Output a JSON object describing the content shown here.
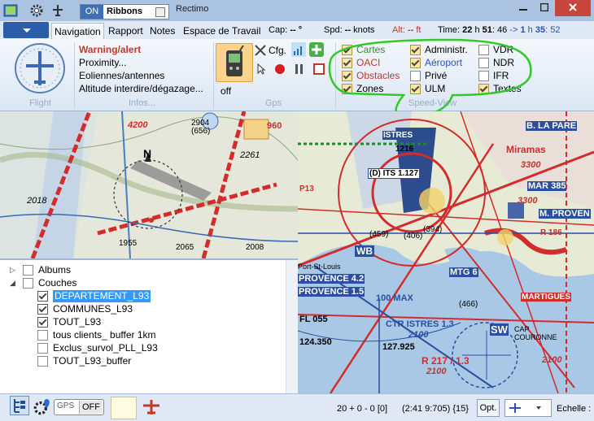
{
  "titlebar": {
    "toggle_on": "ON",
    "toggle_label": "Ribbons",
    "app_title": "Rectimo"
  },
  "menu": {
    "tabs": [
      "Navigation",
      "Rapport",
      "Notes",
      "Espace de Travail"
    ],
    "cap_label": "Cap:",
    "cap_value": "-- °",
    "spd_label": "Spd:",
    "spd_value": "--",
    "spd_unit": "knots",
    "alt_label": "Alt:",
    "alt_value": "--",
    "alt_unit": "ft",
    "time_label": "Time:",
    "time_h": "22",
    "time_h_unit": "h",
    "time_m": "51",
    "time_s": ": 46",
    "time_arrow": "->",
    "time_h2": "1",
    "time_h2_unit": "h",
    "time_m2": "35",
    "time_s2": ": 52"
  },
  "ribbon": {
    "flight_label": "Flight",
    "infos": {
      "items": [
        "Warning/alert",
        "Proximity...",
        "Eoliennes/antennes",
        "Altitude interdire/dégazage..."
      ],
      "label": "Infos..."
    },
    "gps": {
      "off_label": "off",
      "cfg_label": "Cfg.",
      "label": "Gps"
    },
    "speedview": {
      "label": "Speed-View",
      "items": [
        {
          "label": "Cartes",
          "checked": true,
          "color": "#2f8f2f"
        },
        {
          "label": "OACI",
          "checked": true,
          "color": "#c0392b"
        },
        {
          "label": "Obstacles",
          "checked": true,
          "color": "#c0392b"
        },
        {
          "label": "Zones",
          "checked": true,
          "color": "#000000"
        },
        {
          "label": "Administr.",
          "checked": true,
          "color": "#000000"
        },
        {
          "label": "Aéroport",
          "checked": true,
          "color": "#2b4fbf"
        },
        {
          "label": "Privé",
          "checked": false,
          "color": "#000000"
        },
        {
          "label": "ULM",
          "checked": true,
          "color": "#000000"
        },
        {
          "label": "VDR",
          "checked": false,
          "color": "#000000"
        },
        {
          "label": "NDR",
          "checked": false,
          "color": "#000000"
        },
        {
          "label": "IFR",
          "checked": false,
          "color": "#000000"
        },
        {
          "label": "Textes",
          "checked": true,
          "color": "#000000"
        }
      ]
    }
  },
  "left_map": {
    "labels": [
      "4200",
      "2904",
      "(656)",
      "960",
      "2261",
      "2018",
      "1955",
      "2065",
      "2008",
      "N"
    ]
  },
  "right_map": {
    "labels": [
      "ISTRES",
      "1216",
      "Miramas",
      "B. LA PARE",
      "3300",
      "(D) ITS 1.127",
      "P13",
      "MAR 385",
      "M. PROVEN",
      "R 186",
      "WB",
      "Port-St-Louis",
      "PROVENCE 4.2",
      "PROVENCE 1.5",
      "FL 055",
      "124.350",
      "CTR ISTRES 1.3",
      "2100",
      "127.925",
      "R 217 / 1.3",
      "2100",
      "SW",
      "MARTIGUES",
      "CAP COURONNE",
      "100 MAX",
      "2100",
      "MTG 6",
      "(466)",
      "(459)",
      "(406)",
      "(394)",
      "3300"
    ]
  },
  "tree": {
    "items": [
      {
        "label": "Albums",
        "checked": false,
        "level": 0,
        "expander": "▷"
      },
      {
        "label": "Couches",
        "checked": false,
        "level": 0,
        "expander": "◢"
      },
      {
        "label": "DEPARTEMENT_L93",
        "checked": true,
        "level": 1,
        "selected": true
      },
      {
        "label": "COMMUNES_L93",
        "checked": true,
        "level": 1
      },
      {
        "label": "TOUT_L93",
        "checked": true,
        "level": 1
      },
      {
        "label": "tous clients_ buffer 1km",
        "checked": false,
        "level": 1
      },
      {
        "label": "Exclus_survol_PLL_L93",
        "checked": false,
        "level": 1
      },
      {
        "label": "TOUT_L93_buffer",
        "checked": false,
        "level": 1
      }
    ]
  },
  "status": {
    "gps_label": "GPS",
    "gps_state": "OFF",
    "counter": "20 + 0 - 0 [0]",
    "coords": "(2:41  9:705) {15}",
    "opt_label": "Opt.",
    "scale_label": "Echelle :"
  }
}
